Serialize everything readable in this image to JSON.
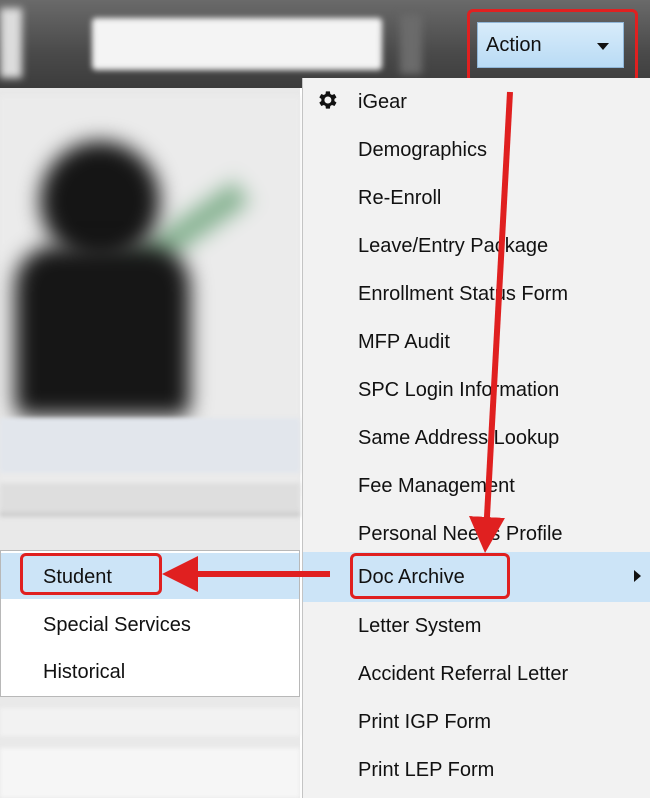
{
  "toolbar": {
    "action_label": "Action"
  },
  "menu": {
    "items": [
      {
        "label": "iGear",
        "icon": "gear-icon"
      },
      {
        "label": "Demographics"
      },
      {
        "label": "Re-Enroll"
      },
      {
        "label": "Leave/Entry Package"
      },
      {
        "label": "Enrollment Status Form"
      },
      {
        "label": "MFP Audit"
      },
      {
        "label": "SPC Login Information"
      },
      {
        "label": "Same Address Lookup"
      },
      {
        "label": "Fee Management"
      },
      {
        "label": "Personal Needs Profile"
      },
      {
        "label": "Doc Archive",
        "has_submenu": true
      },
      {
        "label": "Letter System"
      },
      {
        "label": "Accident Referral Letter"
      },
      {
        "label": "Print IGP Form"
      },
      {
        "label": "Print LEP Form"
      }
    ]
  },
  "submenu": {
    "items": [
      {
        "label": "Student"
      },
      {
        "label": "Special Services"
      },
      {
        "label": "Historical"
      }
    ]
  },
  "colors": {
    "highlight": "#cce4f7",
    "annotation_red": "#e02020",
    "toolbar": "#4a4a4a"
  }
}
